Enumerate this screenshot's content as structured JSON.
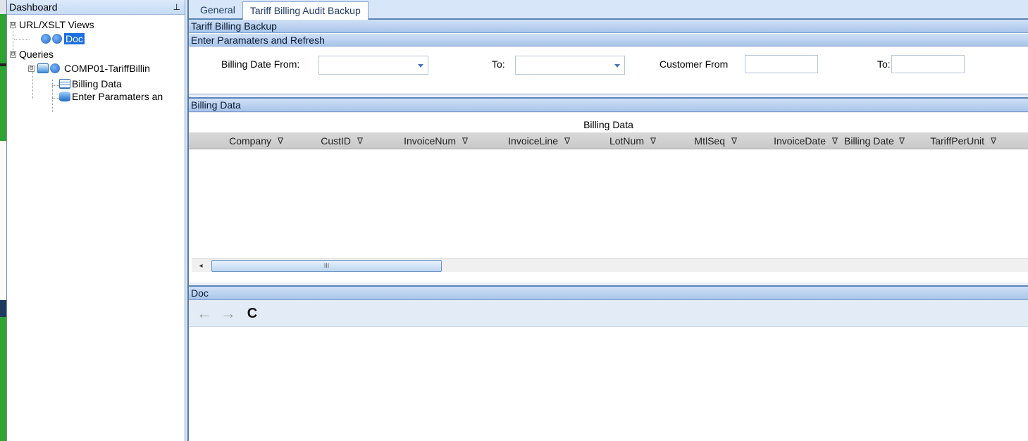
{
  "dashboard": {
    "title": "Dashboard",
    "pin_icon": "pin-icon",
    "tree": {
      "url_views": {
        "label": "URL/XSLT Views",
        "expander": "⊟"
      },
      "doc": {
        "label": "Doc"
      },
      "queries": {
        "label": "Queries",
        "expander": "⊟"
      },
      "query": {
        "label": "COMP01-TariffBillin",
        "expander": "⊟"
      },
      "billing_data": {
        "label": "Billing Data"
      },
      "enter_params": {
        "label": "Enter Paramaters an"
      }
    }
  },
  "tabs": [
    {
      "label": "General",
      "active": false
    },
    {
      "label": "Tariff Billing Audit Backup",
      "active": true
    }
  ],
  "sections": {
    "backup_title": "Tariff Billing Backup",
    "params_title": "Enter Paramaters and Refresh",
    "billing_title": "Billing Data",
    "doc_title": "Doc"
  },
  "params": {
    "billing_date_from_label": "Billing Date From:",
    "billing_date_from_value": "",
    "billing_date_to_label": "To:",
    "billing_date_to_value": "",
    "customer_from_label": "Customer From",
    "customer_from_value": "",
    "customer_to_label": "To:",
    "customer_to_value": ""
  },
  "grid": {
    "band_title": "Billing Data",
    "columns": [
      "Company",
      "CustID",
      "InvoiceNum",
      "InvoiceLine",
      "LotNum",
      "MtlSeq",
      "InvoiceDate",
      "Billing Date",
      "TariffPerUnit"
    ],
    "filter_glyph": "∇",
    "scroll_grip": "III",
    "scroll_left": "◂"
  },
  "doc_toolbar": {
    "back": "←",
    "forward": "→",
    "refresh": "C"
  },
  "colors": {
    "accent": "#5d84b8",
    "selection": "#1c6fe0",
    "bar": "#a9c5ea"
  }
}
